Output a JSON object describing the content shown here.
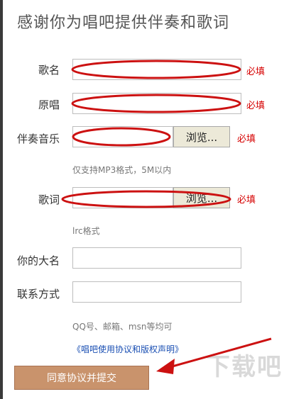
{
  "page": {
    "title": "感谢你为唱吧提供伴奏和歌词"
  },
  "form": {
    "song_name": {
      "label": "歌名",
      "value": "",
      "required": "必填"
    },
    "original_singer": {
      "label": "原唱",
      "value": "",
      "required": "必填"
    },
    "accompaniment": {
      "label": "伴奏音乐",
      "browse_label": "浏览...",
      "required": "必填",
      "hint": "仅支持MP3格式，5M以内"
    },
    "lyrics": {
      "label": "歌词",
      "browse_label": "浏览...",
      "required": "必填",
      "hint": "lrc格式"
    },
    "your_name": {
      "label": "你的大名",
      "value": ""
    },
    "contact": {
      "label": "联系方式",
      "value": "",
      "hint": "QQ号、邮箱、msn等均可"
    }
  },
  "agreement_link": "《唱吧使用协议和版权声明》",
  "submit_label": "同意协议并提交",
  "colors": {
    "annotation_red": "#cc1111",
    "submit_bg": "#c9936c",
    "required_red": "#d60000",
    "link_blue": "#1a4fb3"
  }
}
